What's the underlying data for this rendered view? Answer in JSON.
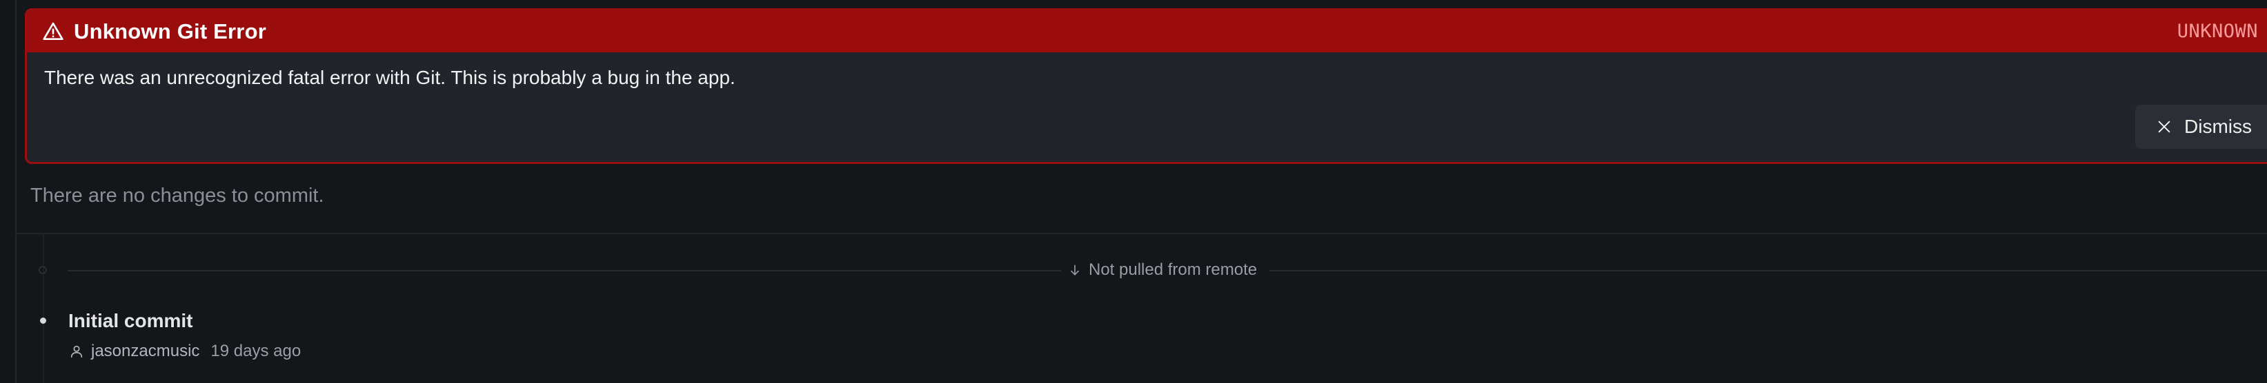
{
  "error": {
    "title": "Unknown Git Error",
    "code": "UNKNOWN",
    "message": "There was an unrecognized fatal error with Git. This is probably a bug in the app.",
    "dismiss_label": "Dismiss",
    "icon": "warning-triangle-icon",
    "colors": {
      "header_bg": "#9b0d0d",
      "code_text": "#ff9a9a"
    }
  },
  "status": {
    "no_changes": "There are no changes to commit."
  },
  "history": {
    "remote_divider_label": "Not pulled from remote",
    "remote_icon": "arrow-down-icon",
    "commits": [
      {
        "title": "Initial commit",
        "author": "jasonzacmusic",
        "time": "19 days ago",
        "author_icon": "user-icon"
      }
    ]
  }
}
